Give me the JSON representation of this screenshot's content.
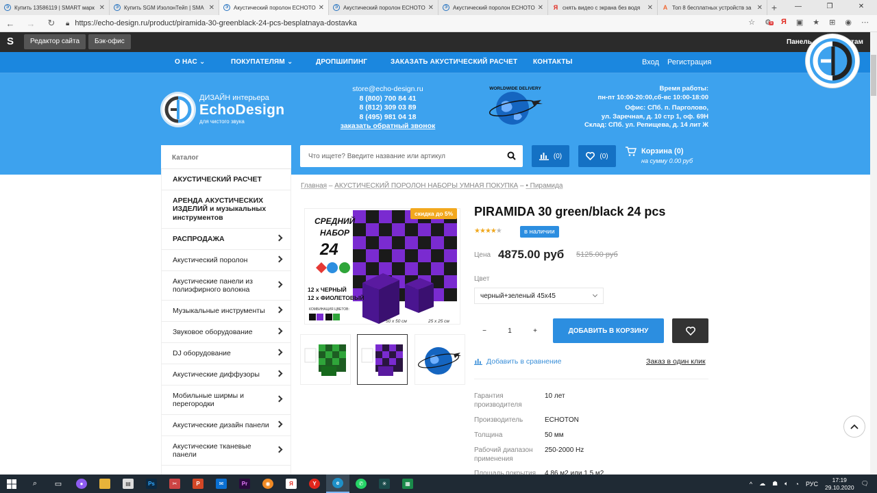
{
  "browser": {
    "tabs": [
      {
        "title": "Купить 13586119 | SMART марк",
        "icon": "echo-design-favicon",
        "active": false
      },
      {
        "title": "Купить SGM ИзолонТейп | SMA",
        "icon": "echo-design-favicon",
        "active": false
      },
      {
        "title": "Акустический поролон ECHOTO",
        "icon": "echo-design-favicon",
        "active": true
      },
      {
        "title": "Акустический поролон ECHOTO",
        "icon": "echo-design-favicon",
        "active": false
      },
      {
        "title": "Акустический поролон ECHOTO",
        "icon": "echo-design-favicon",
        "active": false
      },
      {
        "title": "снять видео с экрана без водя",
        "icon": "yandex-favicon",
        "active": false
      },
      {
        "title": "Топ 8 бесплатных устройств за",
        "icon": "article-favicon",
        "active": false
      }
    ],
    "new_tab": "+",
    "url": "https://echo-design.ru/product/piramida-30-greenblack-24-pcs-besplatnaya-dostavka",
    "badge_count": "5"
  },
  "admin_bar": {
    "site_editor": "Редактор сайта",
    "back_office": "Бэк-офис",
    "right_text_a": "Панель",
    "right_text_b": "нтам"
  },
  "nav": {
    "items": [
      "О НАС",
      "ПОКУПАТЕЛЯМ",
      "ДРОПШИПИНГ",
      "ЗАКАЗАТЬ АКУСТИЧЕСКИЙ РАСЧЕТ",
      "КОНТАКТЫ"
    ],
    "login": "Вход",
    "register": "Регистрация"
  },
  "header": {
    "logo_sub1": "ДИЗАЙН интерьера",
    "logo_name": "EchoDesign",
    "logo_sub2": "для чистого звука",
    "email": "store@echo-design.ru",
    "phones": [
      "8 (800) 700 84 41",
      "8 (812) 309 03 89",
      "8 (495) 981 04 18"
    ],
    "callback": "заказать обратный звонок",
    "globe_caption": "WORLDWIDE DELIVERY",
    "hours_title": "Время работы:",
    "hours": "пн-пт 10:00-20:00,сб-вс 10:00-18:00",
    "office": "Офис: СПб. п. Парголово,",
    "office2": "ул. Заречная, д. 10 стр 1, оф. 69Н",
    "warehouse": "Склад: СПб. ул. Репищева, д. 14 лит Ж"
  },
  "search": {
    "catalog_label": "Каталог",
    "placeholder": "Что ищете? Введите название или артикул",
    "compare_count": "(0)",
    "fav_count": "(0)",
    "cart_title": "Корзина (0)",
    "cart_sum": "на сумму 0.00 руб"
  },
  "sidebar": {
    "items": [
      {
        "label": "АКУСТИЧЕСКИЙ РАСЧЕТ",
        "caps": true,
        "arrow": false,
        "h": 31
      },
      {
        "label": "АРЕНДА АКУСТИЧЕСКИХ ИЗДЕЛИЙ и музыкальных инструментов",
        "caps": true,
        "arrow": false,
        "h": 56
      },
      {
        "label": "РАСПРОДАЖА",
        "caps": true,
        "arrow": true,
        "h": 31
      },
      {
        "label": "Акустический поролон",
        "caps": false,
        "arrow": true,
        "h": 31
      },
      {
        "label": "Акустические панели из полиэфирного волокна",
        "caps": false,
        "arrow": true,
        "h": 43
      },
      {
        "label": "Музыкальные инструменты",
        "caps": false,
        "arrow": true,
        "h": 31
      },
      {
        "label": "Звуковое оборудование",
        "caps": false,
        "arrow": true,
        "h": 31
      },
      {
        "label": "DJ оборудование",
        "caps": false,
        "arrow": true,
        "h": 31
      },
      {
        "label": "Акустические диффузоры",
        "caps": false,
        "arrow": true,
        "h": 31
      },
      {
        "label": "Мобильные ширмы и перегородки",
        "caps": false,
        "arrow": true,
        "h": 43
      },
      {
        "label": "Акустические дизайн панели",
        "caps": false,
        "arrow": true,
        "h": 31
      },
      {
        "label": "Акустические тканевые панели",
        "caps": false,
        "arrow": true,
        "h": 43
      }
    ]
  },
  "breadcrumb": {
    "items": [
      "Главная",
      "АКУСТИЧЕСКИЙ ПОРОЛОН НАБОРЫ УМНАЯ ПОКУПКА",
      "• Пирамида"
    ],
    "sep": "–"
  },
  "product": {
    "title": "PIRAMIDA 30 green/black 24 pcs",
    "rating": 4,
    "in_stock": "в наличии",
    "price_label": "Цена",
    "price": "4875.00 руб",
    "old_price": "5125.00 руб",
    "discount": "скидка до 5%",
    "color_label": "Цвет",
    "color_value": "черный+зеленый 45х45",
    "qty": "1",
    "qty_minus": "−",
    "qty_plus": "+",
    "add_to_cart": "ДОБАВИТЬ В КОРЗИНУ",
    "compare": "Добавить в сравнение",
    "one_click": "Заказ в один клик",
    "image_text": {
      "line1": "СРЕДНИЙ",
      "line2": "НАБОР",
      "count": "24",
      "line3": "12 х ЧЕРНЫЙ",
      "line4": "12 х ФИОЛЕТОВЫЙ",
      "combo": "КОМБИНАЦИЯ ЦВЕТОВ:",
      "dim1": "50 х 50 см",
      "dim2": "25 х 25 см"
    },
    "specs": [
      {
        "k": "Гарантия производителя",
        "v": "10 лет"
      },
      {
        "k": "Производитель",
        "v": "ECHOTON"
      },
      {
        "k": "Толщина",
        "v": "50 мм"
      },
      {
        "k": "Рабочий диапазон применения",
        "v": "250-2000 Hz"
      },
      {
        "k": "Площадь покрытия",
        "v": "4.86 м2 или 1.5 м2"
      }
    ]
  },
  "taskbar": {
    "lang": "РУС",
    "time": "17:19",
    "date": "29.10.2020"
  },
  "colors": {
    "nav_blue": "#1b87df",
    "header_blue": "#3da2ee",
    "button_blue": "#2c8ee0",
    "discount_orange": "#f2a81e",
    "foam_purple": "#7a2bd0",
    "foam_green": "#2fa53a"
  }
}
